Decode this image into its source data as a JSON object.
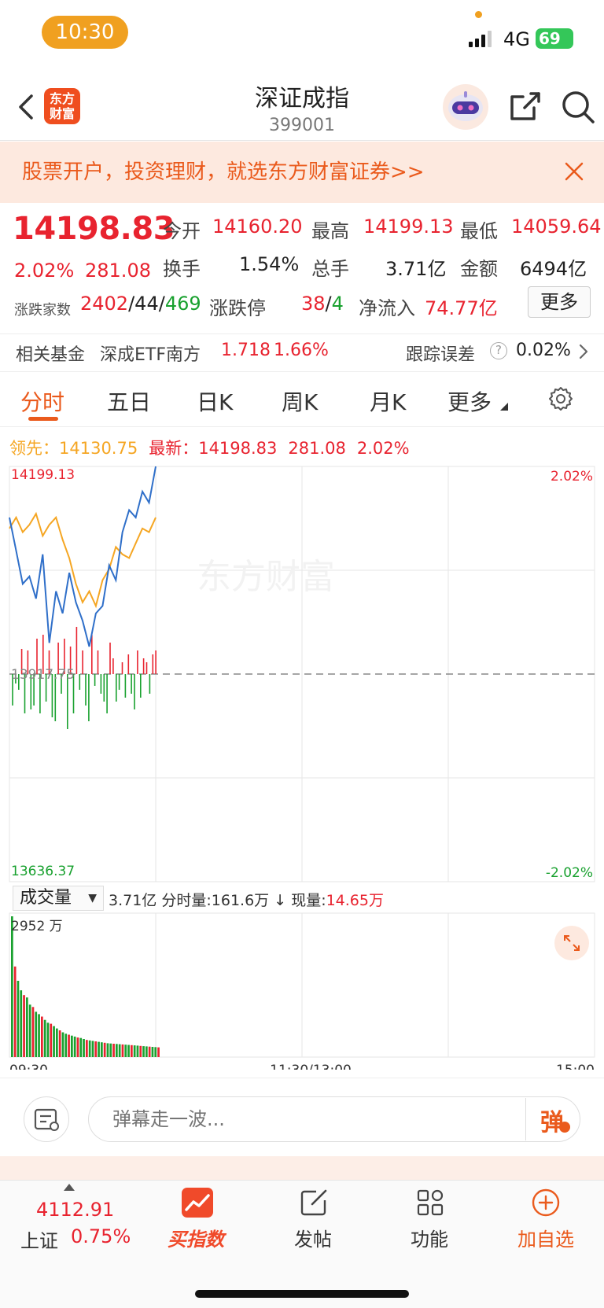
{
  "status": {
    "time": "10:30",
    "network": "4G",
    "battery": "69"
  },
  "header": {
    "title": "深证成指",
    "code": "399001",
    "logo_text_line1": "东方",
    "logo_text_line2": "财富"
  },
  "banner": {
    "text": "股票开户，投资理财，就选东方财富证券>>"
  },
  "quote": {
    "price": "14198.83",
    "change_pct": "2.02%",
    "change_val": "281.08",
    "open_label": "今开",
    "open": "14160.20",
    "high_label": "最高",
    "high": "14199.13",
    "low_label": "最低",
    "low": "14059.64",
    "turnover_label": "换手",
    "turnover": "1.54%",
    "volume_label": "总手",
    "volume": "3.71亿",
    "amount_label": "金额",
    "amount": "6494亿",
    "breadth_label": "涨跌家数",
    "up": "2402",
    "flat": "44",
    "down": "469",
    "limit_label": "涨跌停",
    "limit_up": "38",
    "limit_down": "4",
    "inflow_label": "净流入",
    "inflow": "74.77亿",
    "more": "更多"
  },
  "fund": {
    "label": "相关基金",
    "name": "深成ETF南方",
    "price": "1.718",
    "pct": "1.66%",
    "track_label": "跟踪误差",
    "track_value": "0.02%"
  },
  "tabs": [
    "分时",
    "五日",
    "日K",
    "周K",
    "月K",
    "更多"
  ],
  "legend": {
    "lead_label": "领先：",
    "lead_value": "14130.75",
    "latest_label": "最新：",
    "latest_value": "14198.83",
    "latest_change": "281.08",
    "latest_pct": "2.02%"
  },
  "chart_axis": {
    "top_left": "14199.13",
    "top_right": "2.02%",
    "bottom_left": "13636.37",
    "bottom_right": "-2.02%",
    "mid_left": "13917.75",
    "vol_max": "2952 万",
    "time_start": "09:30",
    "time_mid": "11:30/13:00",
    "time_end": "15:00"
  },
  "volume_bar": {
    "dropdown": "成交量",
    "total": "3.71亿",
    "min_label": "分时量:",
    "min_value": "161.6万",
    "cur_label": "现量:",
    "cur_value": "14.65万"
  },
  "watermark": "东方财富",
  "danmaku": {
    "placeholder": "弹幕走一波...",
    "button": "弹"
  },
  "bottom_nav": {
    "sh_price": "4112.91",
    "sh_name": "上证",
    "sh_pct": "0.75%",
    "buy_index": "买指数",
    "post": "发帖",
    "functions": "功能",
    "add_watch": "加自选"
  },
  "colors": {
    "accent": "#ea5a1c",
    "up": "#e8232f",
    "down": "#19a12f",
    "price_line": "#2f6fc9",
    "avg_line": "#f5a623"
  },
  "chart_data": {
    "type": "line",
    "x_range": [
      "09:30",
      "15:00"
    ],
    "ylim": [
      13636.37,
      14199.13
    ],
    "prev_close": 13917.75,
    "series": [
      {
        "name": "最新",
        "values": [
          14130,
          14085,
          14040,
          14050,
          14020,
          14080,
          13960,
          14030,
          14000,
          14055,
          14015,
          13990,
          13955,
          14000,
          14010,
          14065,
          14045,
          14110,
          14140,
          14130,
          14165,
          14150,
          14199
        ]
      },
      {
        "name": "领先",
        "values": [
          14115,
          14130,
          14110,
          14120,
          14135,
          14105,
          14120,
          14130,
          14100,
          14075,
          14040,
          14015,
          14030,
          14010,
          14045,
          14060,
          14090,
          14080,
          14075,
          14095,
          14115,
          14110,
          14130
        ]
      }
    ],
    "volume_max": 2952,
    "volume_values": [
      2952,
      1900,
      1600,
      1400,
      1300,
      1250,
      1100,
      1050,
      950,
      900,
      850,
      780,
      720,
      700,
      650,
      600,
      560,
      520,
      490,
      470,
      450,
      430,
      410,
      400,
      380,
      360,
      350,
      340,
      330,
      320,
      310,
      300,
      290,
      285,
      280,
      275,
      270,
      265,
      260,
      255,
      250,
      245,
      240,
      235,
      230,
      225,
      220,
      215,
      210,
      205
    ]
  }
}
